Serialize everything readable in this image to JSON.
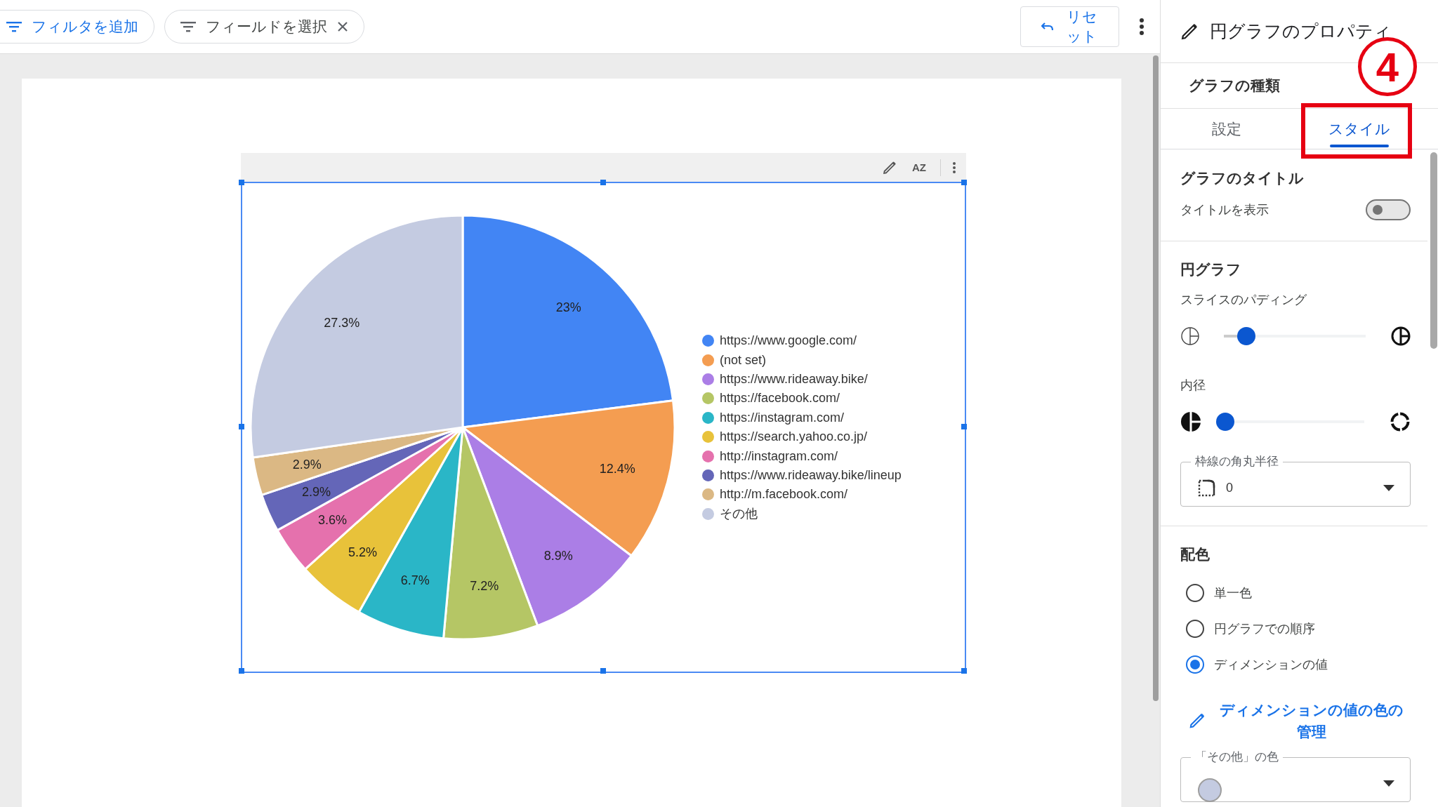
{
  "toolbar": {
    "chips": [
      {
        "kind": "add",
        "label": "フィルタを追加"
      },
      {
        "kind": "field",
        "label": "フィールドを選択"
      }
    ],
    "reset_button": "リセット"
  },
  "chart": {
    "sort_button": "AZ",
    "chart_data": {
      "type": "pie",
      "legend": "right",
      "categories": [
        "https://www.google.com/",
        "(not set)",
        "https://www.rideaway.bike/",
        "https://facebook.com/",
        "https://instagram.com/",
        "https://search.yahoo.co.jp/",
        "http://instagram.com/",
        "https://www.rideaway.bike/lineup",
        "http://m.facebook.com/",
        "その他"
      ],
      "values": [
        23,
        12.4,
        8.9,
        7.2,
        6.7,
        5.2,
        3.6,
        2.9,
        2.9,
        27.3
      ],
      "value_labels": [
        "23%",
        "12.4%",
        "8.9%",
        "7.2%",
        "6.7%",
        "5.2%",
        "3.6%",
        "2.9%",
        "2.9%",
        "27.3%"
      ],
      "colors": [
        "#4285f4",
        "#f49d51",
        "#ab7ee6",
        "#b5c665",
        "#2ab6c7",
        "#e8c23a",
        "#e571ad",
        "#6466b8",
        "#dbb884",
        "#c4cbe1"
      ]
    }
  },
  "panel": {
    "title": "円グラフのプロパティ",
    "chart_type_label": "グラフの種類",
    "tabs": [
      {
        "label": "設定",
        "selected": false
      },
      {
        "label": "スタイル",
        "selected": true
      }
    ],
    "sections": [
      {
        "heading": "グラフのタイトル",
        "controls": [
          {
            "kind": "toggle",
            "label": "タイトルを表示",
            "on": false
          }
        ]
      },
      {
        "heading": "円グラフ",
        "controls": [
          {
            "kind": "slider",
            "label": "スライスのパディング",
            "level": 0.16
          },
          {
            "kind": "slider",
            "label": "内径",
            "level": 0
          },
          {
            "kind": "dropdown",
            "label": "枠線の角丸半径",
            "value": "0"
          }
        ]
      },
      {
        "heading": "配色",
        "controls": [
          {
            "kind": "radio",
            "label": "単一色",
            "selected": false
          },
          {
            "kind": "radio",
            "label": "円グラフでの順序",
            "selected": false
          },
          {
            "kind": "radio",
            "label": "ディメンションの値",
            "selected": true
          },
          {
            "kind": "link",
            "label": "ディメンションの値の色の管理"
          },
          {
            "kind": "swatch",
            "label": "「その他」の色",
            "color": "#c4cbe1"
          }
        ]
      }
    ]
  },
  "annotation": {
    "label": "4"
  }
}
